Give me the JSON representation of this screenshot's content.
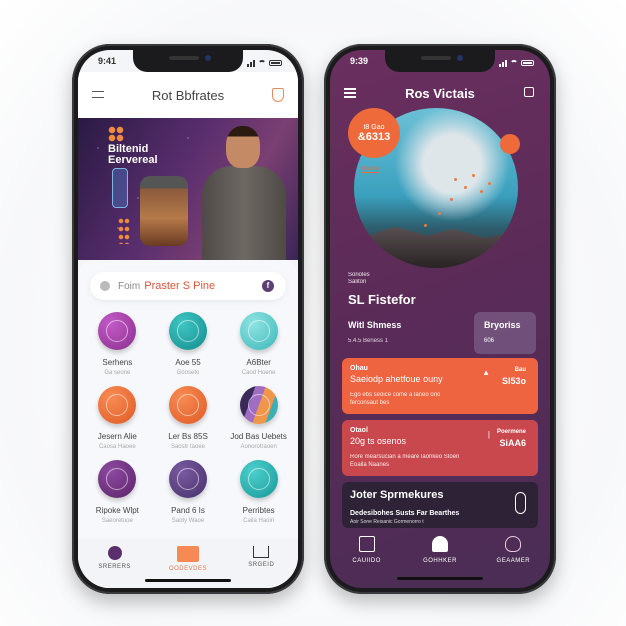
{
  "left_phone": {
    "status": {
      "time": "9:41"
    },
    "header": {
      "title": "Rot Bbfrates",
      "menu_icon": "hamburger-icon",
      "action_icon": "shield-icon"
    },
    "hero": {
      "title_line1": "Biltenid",
      "title_line2": "Eervereal"
    },
    "search": {
      "label": "Foim",
      "value": "Praster S Pine",
      "leading_icon": "google-icon",
      "trailing_icon": "facebook-icon",
      "trailing_glyph": "f"
    },
    "grid": [
      {
        "name": "Serhens",
        "sub": "Ga seone",
        "color": "#9c3fa0",
        "icon": "disc-icon"
      },
      {
        "name": "Aoe 55",
        "sub": "Gooseto",
        "color": "#1ea8a8",
        "icon": "badge-icon"
      },
      {
        "name": "A6Bter",
        "sub": "Caod Hoene",
        "color": "#4ec8c8",
        "icon": "disc-icon"
      },
      {
        "name": "Jesern Alie",
        "sub": "Caosa Haoee",
        "color": "#ef6e34",
        "icon": "rope-icon"
      },
      {
        "name": "Ler Bs 85S",
        "sub": "Saostr taoee",
        "color": "#ef6e34",
        "icon": "bow-icon"
      },
      {
        "name": "Jod Bas Uebets",
        "sub": "Aonorotraoen",
        "color": "#5a3a78",
        "icon": "stack-icon"
      },
      {
        "name": "Ripoke Wlpt",
        "sub": "Saeoretuoe",
        "color": "#6e2f7e",
        "icon": "ribbon-icon"
      },
      {
        "name": "Pand 6 Is",
        "sub": "Saoty Waoe",
        "color": "#5a3a78",
        "icon": "rings-icon"
      },
      {
        "name": "Perribtes",
        "sub": "Caila Haoin",
        "color": "#22a8a8",
        "icon": "swirl-icon"
      }
    ],
    "tabbar": [
      {
        "label": "SRERERS",
        "icon": "phone-icon",
        "active": false
      },
      {
        "label": "OODEVDES",
        "icon": "square-icon",
        "active": true
      },
      {
        "label": "SRGEID",
        "icon": "sofa-icon",
        "active": false
      }
    ],
    "colors": {
      "accent": "#ef6e34",
      "purple": "#5b3f73",
      "background": "#f4f5f8"
    }
  },
  "right_phone": {
    "status": {
      "time": "9:39"
    },
    "header": {
      "title": "Ros Victais",
      "menu_icon": "hamburger-icon",
      "action_icon": "square-icon"
    },
    "globe": {
      "badge_line1": "t8 Gao",
      "badge_line2": "&6313",
      "tag": "Dooraly"
    },
    "caption": {
      "line1": "Sorioles",
      "line2": "Saliton",
      "title": "SL Fistefor"
    },
    "stats": {
      "left_title": "Witl Shmess",
      "left_sub": "5.4.5 Beness 1",
      "right_title": "Bryoriss",
      "right_value": "606"
    },
    "cards": [
      {
        "kicker": "Ohau",
        "title": "Saeiodp ahetfoue ouny",
        "desc": "Ego ebs seoice come a laneo ono ferconsaut bes",
        "aside_key": "Bau",
        "aside_value": "SI53o",
        "arrow": "▲"
      },
      {
        "kicker": "Otaol",
        "title": "20g ts osenos",
        "desc": "Rore mearsucian a meare laonkeo Stoen Eoaila Naanes",
        "aside_key": "Poermene",
        "aside_value": "SiAA6",
        "arrow": "|"
      },
      {
        "title": "Joter Sprmekures",
        "sub1": "Dedesibohes Susts Far Bearthes",
        "sub2": "Aoir Sone Reisanic Gormenorro t"
      }
    ],
    "tabbar": [
      {
        "label": "CAUIIDO",
        "icon": "camera-icon"
      },
      {
        "label": "GOHHKER",
        "icon": "house-icon"
      },
      {
        "label": "GEAAMER",
        "icon": "heart-icon"
      }
    ],
    "colors": {
      "bg_top": "#6a2f5e",
      "bg_bottom": "#4a2d55",
      "card_orange": "#ee6340",
      "card_red": "#c9484e",
      "card_dark": "#2d2236"
    }
  }
}
